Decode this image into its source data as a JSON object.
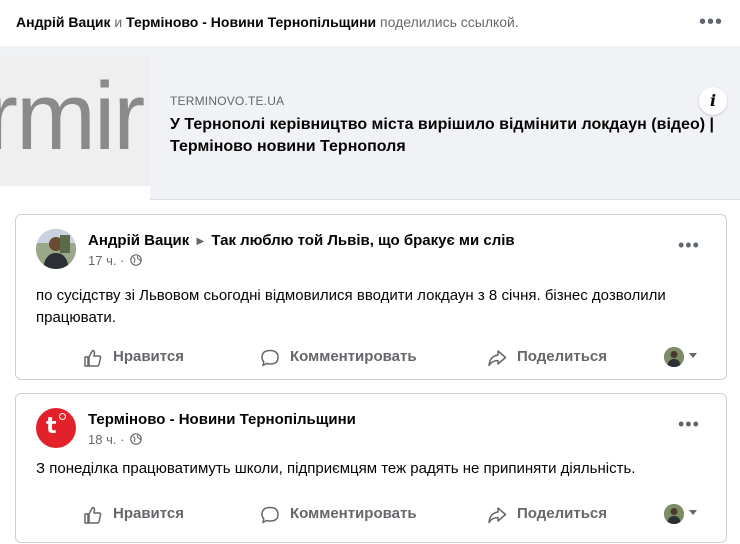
{
  "header": {
    "author1": "Андрій Вацик",
    "conj": "и",
    "author2": "Терміново - Новини Тернопільщини",
    "action": "поделились ссылкой."
  },
  "link": {
    "thumb_text": "rmir",
    "domain": "TERMINOVO.TE.UA",
    "title": "У Тернополі керівництво міста вирішило відмінити локдаун (відео) | Терміново новини Тернополя"
  },
  "posts": [
    {
      "author": "Андрій Вацик",
      "group": "Так люблю той Львів, що бракує ми слів",
      "time": "17 ч.",
      "text": "по сусідству зі Львовом сьогодні відмовилися вводити локдаун з 8 січня. бізнес дозволили працювати."
    },
    {
      "author": "Терміново - Новини Тернопільщини",
      "time": "18 ч.",
      "text": "З понеділка працюватимуть школи, підприємцям теж радять не припиняти діяльність."
    }
  ],
  "actions": {
    "like": "Нравится",
    "comment": "Комментировать",
    "share": "Поделиться"
  },
  "icons": {
    "more": "more-dots-icon",
    "info": "info-icon",
    "globe": "globe-icon",
    "like": "thumbs-up-icon",
    "comment": "comment-bubble-icon",
    "share": "share-arrow-icon"
  }
}
